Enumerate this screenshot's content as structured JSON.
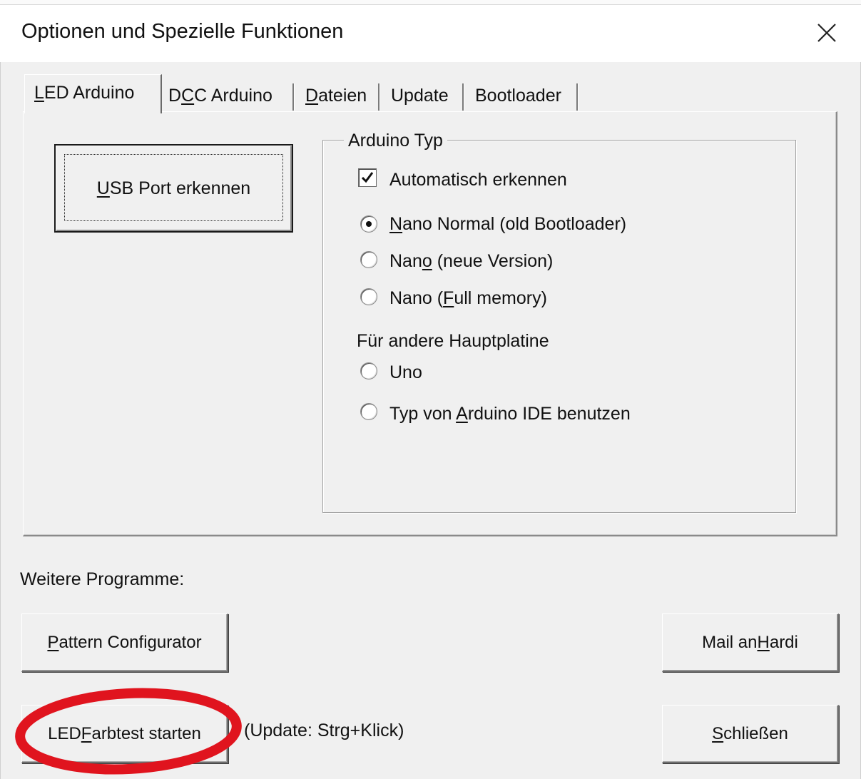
{
  "window": {
    "title": "Optionen und Spezielle Funktionen",
    "close_icon": "close-icon"
  },
  "tabs": [
    {
      "pre": "",
      "key": "L",
      "post": "ED Arduino",
      "active": true
    },
    {
      "pre": "D",
      "key": "C",
      "post": "C Arduino",
      "active": false
    },
    {
      "pre": "",
      "key": "D",
      "post": "ateien",
      "active": false
    },
    {
      "pre": "",
      "key": "",
      "post": "Update",
      "active": false
    },
    {
      "pre": "",
      "key": "",
      "post": "Bootloader",
      "active": false
    }
  ],
  "usb_button": {
    "pre": "",
    "key": "U",
    "post": "SB Port erkennen"
  },
  "arduino_type": {
    "legend": "Arduino Typ",
    "auto_detect": {
      "label": "Automatisch erkennen",
      "checked": true
    },
    "options": [
      {
        "pre": "",
        "key": "N",
        "post": "ano Normal (old Bootloader)",
        "selected": true
      },
      {
        "pre": "Nan",
        "key": "o",
        "post": " (neue Version)",
        "selected": false
      },
      {
        "pre": "Nano (",
        "key": "F",
        "post": "ull memory)",
        "selected": false
      }
    ],
    "other_label": "Für andere Hauptplatine",
    "other_options": [
      {
        "pre": "Uno",
        "key": "",
        "post": "",
        "selected": false
      },
      {
        "pre": "Typ von ",
        "key": "A",
        "post": "rduino IDE benutzen",
        "selected": false
      }
    ]
  },
  "more_programs": {
    "label": "Weitere Programme:",
    "pattern_button": {
      "pre": "",
      "key": "P",
      "post": "attern Configurator"
    },
    "mail_button": {
      "pre": "Mail an ",
      "key": "H",
      "post": "ardi"
    },
    "led_test_button": {
      "pre": "LED ",
      "key": "F",
      "post": "arbtest starten"
    },
    "update_hint": "(Update: Strg+Klick)",
    "close_button": {
      "pre": "",
      "key": "S",
      "post": "chließen"
    }
  },
  "annotation": {
    "color": "#e0141e"
  }
}
